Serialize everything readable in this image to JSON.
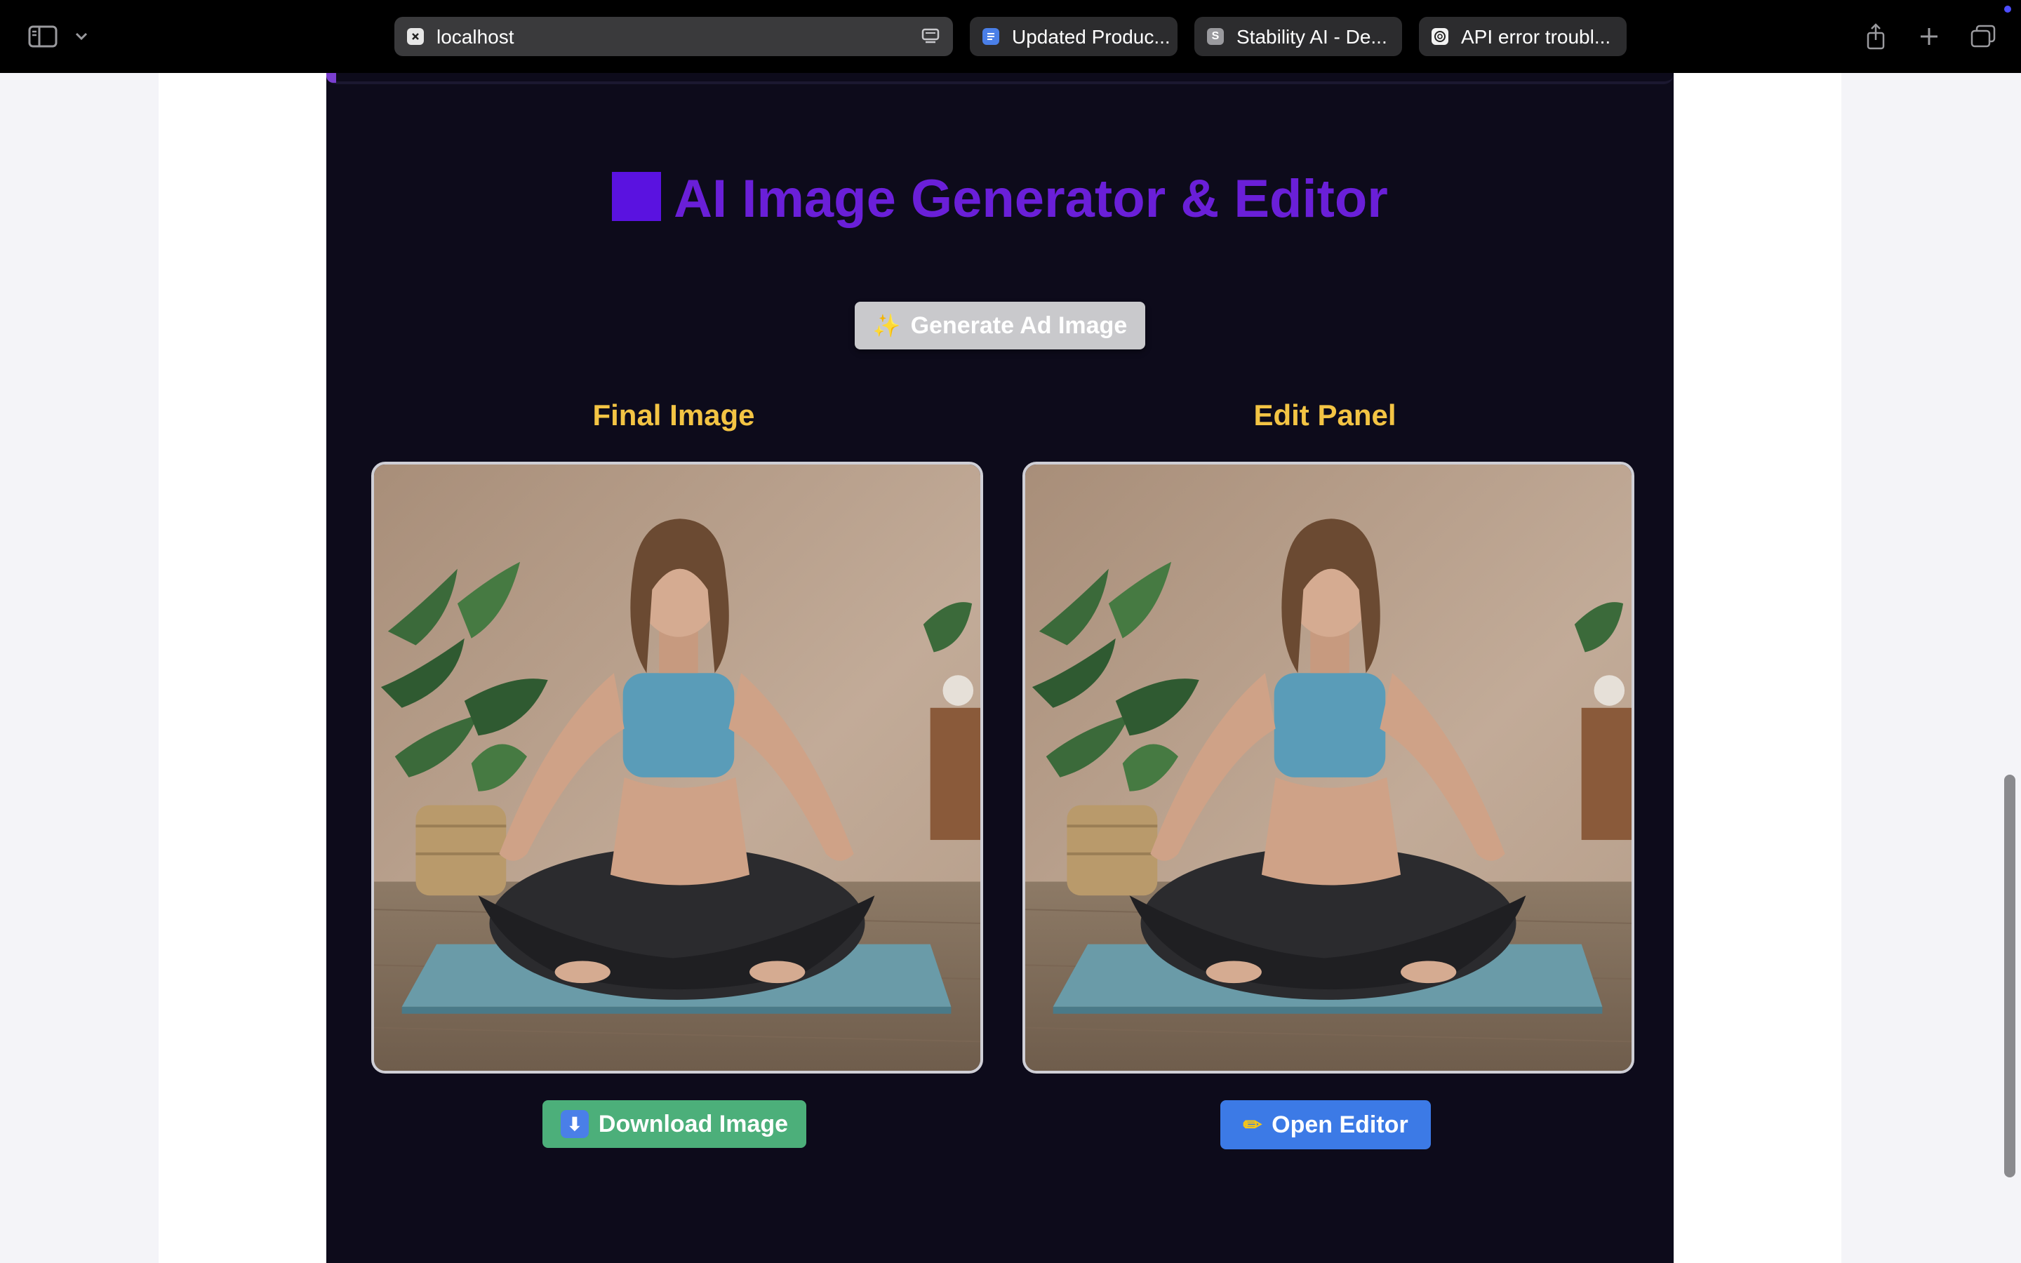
{
  "browser": {
    "address": "localhost",
    "tabs": [
      {
        "label": "Updated Produc...",
        "icon": "docs-icon"
      },
      {
        "label": "Stability AI - De...",
        "icon": "stability-s-icon",
        "favicon_letter": "S"
      },
      {
        "label": "API error troubl...",
        "icon": "openai-icon"
      }
    ]
  },
  "app": {
    "title": "AI Image Generator & Editor",
    "generate_button": {
      "icon": "sparkles-icon",
      "label": "Generate Ad Image"
    },
    "final_panel": {
      "title": "Final Image",
      "image_description": "woman-meditating-on-yoga-mat",
      "button": {
        "icon": "down-arrow-icon",
        "label": "Download Image"
      }
    },
    "edit_panel": {
      "title": "Edit Panel",
      "image_description": "woman-meditating-on-yoga-mat",
      "button": {
        "icon": "pencil-icon",
        "label": "Open Editor"
      }
    }
  },
  "colors": {
    "app_background": "#0d0b1b",
    "title_purple": "#6a1fd8",
    "section_title_yellow": "#f3c444",
    "download_green": "#4caf7a",
    "editor_blue": "#3c7ae6",
    "generate_gray": "#c9c9cc"
  }
}
